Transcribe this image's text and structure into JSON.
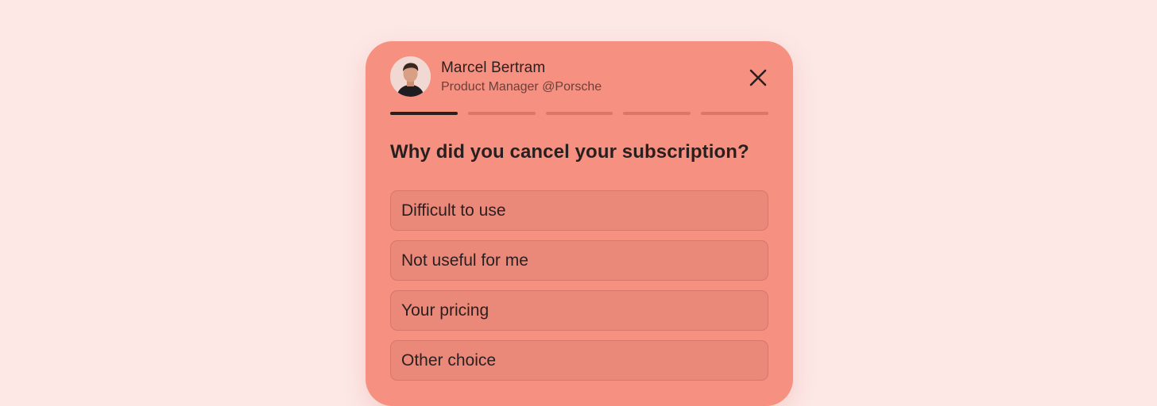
{
  "user": {
    "name": "Marcel Bertram",
    "role": "Product Manager @Porsche",
    "avatar_icon": "person-avatar"
  },
  "close_icon": "close-icon",
  "progress": {
    "total_steps": 5,
    "current_step": 1
  },
  "question": "Why did you cancel your subscription?",
  "options": [
    {
      "label": "Difficult to use"
    },
    {
      "label": "Not useful for me"
    },
    {
      "label": "Your pricing"
    },
    {
      "label": "Other choice"
    }
  ],
  "colors": {
    "background": "#fde8e6",
    "card": "#f69080",
    "option_fill": "#ea897a",
    "text": "#2a1f1f",
    "progress_active": "#2a1f1f",
    "progress_inactive": "#d9776a"
  }
}
